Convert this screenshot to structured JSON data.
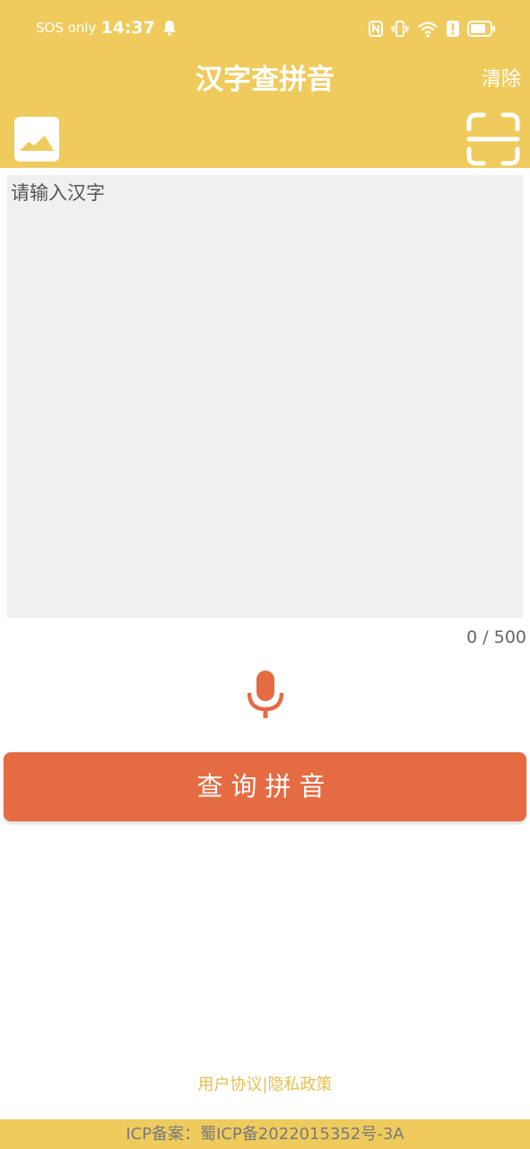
{
  "status_bar": {
    "sos": "SOS only",
    "time": "14:37",
    "icons": [
      "bell-icon",
      "nfc-icon",
      "vibrate-icon",
      "wifi-icon",
      "alert-icon",
      "battery-icon"
    ]
  },
  "header": {
    "title": "汉字查拼音",
    "clear_label": "清除",
    "left_icon": "image-icon",
    "right_icon": "scan-icon"
  },
  "input": {
    "value": "",
    "placeholder": "请输入汉字",
    "counter": "0 / 500"
  },
  "voice": {
    "icon": "microphone-icon"
  },
  "actions": {
    "query_label": "查询拼音"
  },
  "footer": {
    "links": "用户协议|隐私政策",
    "icp": "ICP备案：蜀ICP备2022015352号-3A"
  },
  "colors": {
    "header_bg": "#EFCB5E",
    "button_bg": "#E56B43",
    "input_bg": "#F0F0F0",
    "link": "#E5C04E"
  }
}
